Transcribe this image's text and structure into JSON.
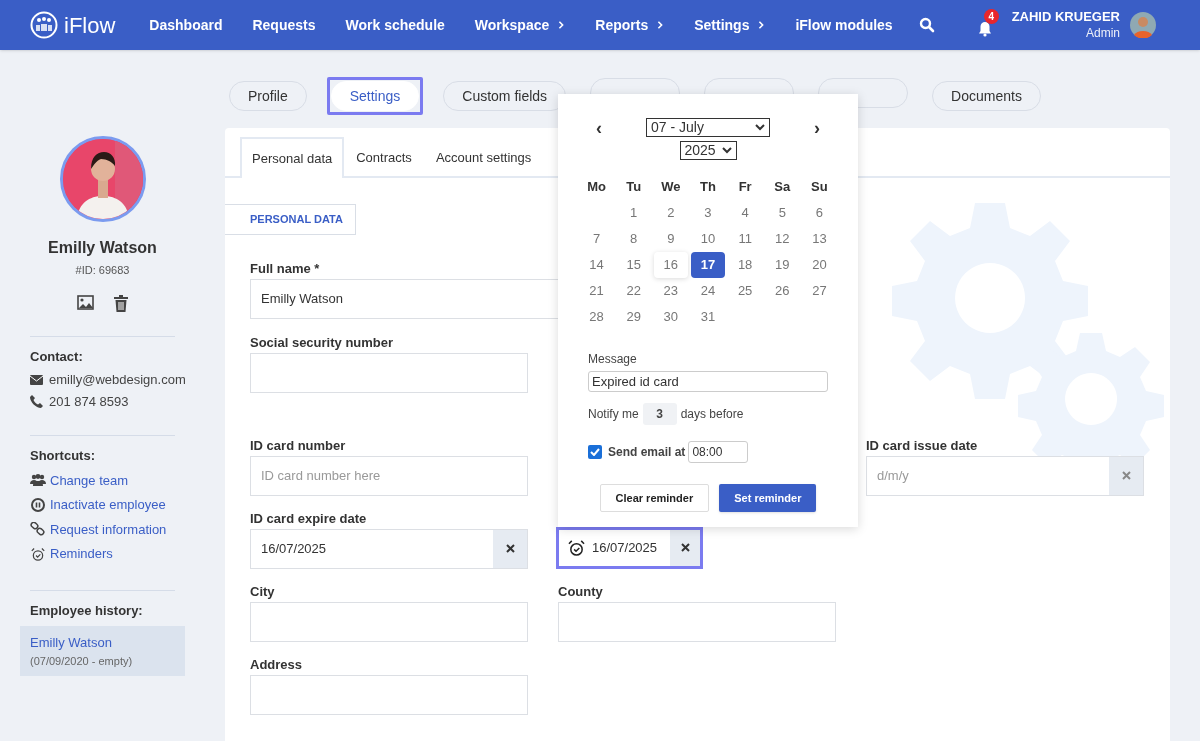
{
  "brand": {
    "name": "iFlow"
  },
  "nav": [
    {
      "label": "Dashboard",
      "submenu": false
    },
    {
      "label": "Requests",
      "submenu": false
    },
    {
      "label": "Work schedule",
      "submenu": false
    },
    {
      "label": "Workspace",
      "submenu": true
    },
    {
      "label": "Reports",
      "submenu": true
    },
    {
      "label": "Settings",
      "submenu": true
    },
    {
      "label": "iFlow modules",
      "submenu": false
    }
  ],
  "notifications": {
    "count": "4"
  },
  "user": {
    "name": "ZAHID KRUEGER",
    "role": "Admin"
  },
  "profile_tabs": [
    {
      "label": "Profile",
      "selected": false
    },
    {
      "label": "Settings",
      "selected": true
    },
    {
      "label": "Custom fields",
      "selected": false
    },
    {
      "selected": false
    },
    {
      "selected": false
    },
    {
      "selected": false
    },
    {
      "label": "Documents",
      "selected": false
    }
  ],
  "sidebar": {
    "name": "Emilly Watson",
    "id": "#ID: 69683",
    "contact_heading": "Contact:",
    "contact": [
      {
        "kind": "email",
        "text": "emilly@webdesign.com"
      },
      {
        "kind": "phone",
        "text": "201 874 8593"
      }
    ],
    "shortcuts_heading": "Shortcuts:",
    "shortcuts": [
      {
        "kind": "team",
        "label": "Change team"
      },
      {
        "kind": "pause",
        "label": "Inactivate employee"
      },
      {
        "kind": "link",
        "label": "Request information"
      },
      {
        "kind": "alarm",
        "label": "Reminders"
      }
    ],
    "history_heading": "Employee history:",
    "history": [
      {
        "name": "Emilly Watson",
        "period": "(07/09/2020 - empty)",
        "selected": true
      }
    ]
  },
  "section_tabs": [
    {
      "label": "Personal data",
      "selected": true
    },
    {
      "label": "Contracts",
      "selected": false
    },
    {
      "label": "Account settings",
      "selected": false
    }
  ],
  "section_label": "PERSONAL DATA",
  "fields": [
    {
      "kind": "text",
      "label": "Full name *",
      "value": "Emilly Watson"
    },
    {
      "kind": "text",
      "label": "Social security number"
    },
    {
      "kind": "text",
      "label": "ID card number",
      "placeholder": "ID card number here"
    },
    {
      "kind": "date",
      "label": "ID card issue date",
      "placeholder": "d/m/y"
    },
    {
      "kind": "date",
      "label": "ID card expire date",
      "value": "16/07/2025"
    },
    {
      "kind": "reminder",
      "value": "16/07/2025"
    },
    {
      "kind": "text",
      "label": "City"
    },
    {
      "kind": "text",
      "label": "County"
    },
    {
      "kind": "text",
      "label": "Address"
    }
  ],
  "datepicker": {
    "prev": "‹",
    "next": "›",
    "month": "07 - July",
    "year": "2025",
    "weekdays": [
      "Mo",
      "Tu",
      "We",
      "Th",
      "Fr",
      "Sa",
      "Su"
    ],
    "days": [
      {
        "kind": "blank"
      },
      {
        "kind": "day",
        "label": "1",
        "selected": false,
        "current": false
      },
      {
        "kind": "day",
        "label": "2",
        "selected": false,
        "current": false
      },
      {
        "kind": "day",
        "label": "3",
        "selected": false,
        "current": false
      },
      {
        "kind": "day",
        "label": "4",
        "selected": false,
        "current": false
      },
      {
        "kind": "day",
        "label": "5",
        "selected": false,
        "current": false
      },
      {
        "kind": "day",
        "label": "6",
        "selected": false,
        "current": false
      },
      {
        "kind": "day",
        "label": "7",
        "selected": false,
        "current": false
      },
      {
        "kind": "day",
        "label": "8",
        "selected": false,
        "current": false
      },
      {
        "kind": "day",
        "label": "9",
        "selected": false,
        "current": false
      },
      {
        "kind": "day",
        "label": "10",
        "selected": false,
        "current": false
      },
      {
        "kind": "day",
        "label": "11",
        "selected": false,
        "current": false
      },
      {
        "kind": "day",
        "label": "12",
        "selected": false,
        "current": false
      },
      {
        "kind": "day",
        "label": "13",
        "selected": false,
        "current": false
      },
      {
        "kind": "day",
        "label": "14",
        "selected": false,
        "current": false
      },
      {
        "kind": "day",
        "label": "15",
        "selected": false,
        "current": false
      },
      {
        "kind": "day",
        "label": "16",
        "selected": false,
        "current": true
      },
      {
        "kind": "day",
        "label": "17",
        "selected": true,
        "current": false
      },
      {
        "kind": "day",
        "label": "18",
        "selected": false,
        "current": false
      },
      {
        "kind": "day",
        "label": "19",
        "selected": false,
        "current": false
      },
      {
        "kind": "day",
        "label": "20",
        "selected": false,
        "current": false
      },
      {
        "kind": "day",
        "label": "21",
        "selected": false,
        "current": false
      },
      {
        "kind": "day",
        "label": "22",
        "selected": false,
        "current": false
      },
      {
        "kind": "day",
        "label": "23",
        "selected": false,
        "current": false
      },
      {
        "kind": "day",
        "label": "24",
        "selected": false,
        "current": false
      },
      {
        "kind": "day",
        "label": "25",
        "selected": false,
        "current": false
      },
      {
        "kind": "day",
        "label": "26",
        "selected": false,
        "current": false
      },
      {
        "kind": "day",
        "label": "27",
        "selected": false,
        "current": false
      },
      {
        "kind": "day",
        "label": "28",
        "selected": false,
        "current": false
      },
      {
        "kind": "day",
        "label": "29",
        "selected": false,
        "current": false
      },
      {
        "kind": "day",
        "label": "30",
        "selected": false,
        "current": false
      },
      {
        "kind": "day",
        "label": "31",
        "selected": false,
        "current": false
      }
    ],
    "message_label": "Message",
    "message": "Expired id card",
    "notify_label": "Notify me",
    "notify_days": "3",
    "notify_suffix": "days before",
    "send_email": {
      "checked": true,
      "label": "Send email at",
      "time": "08:00"
    },
    "buttons": [
      {
        "kind": "secondary",
        "label": "Clear reminder"
      },
      {
        "kind": "primary",
        "label": "Set reminder"
      }
    ]
  }
}
